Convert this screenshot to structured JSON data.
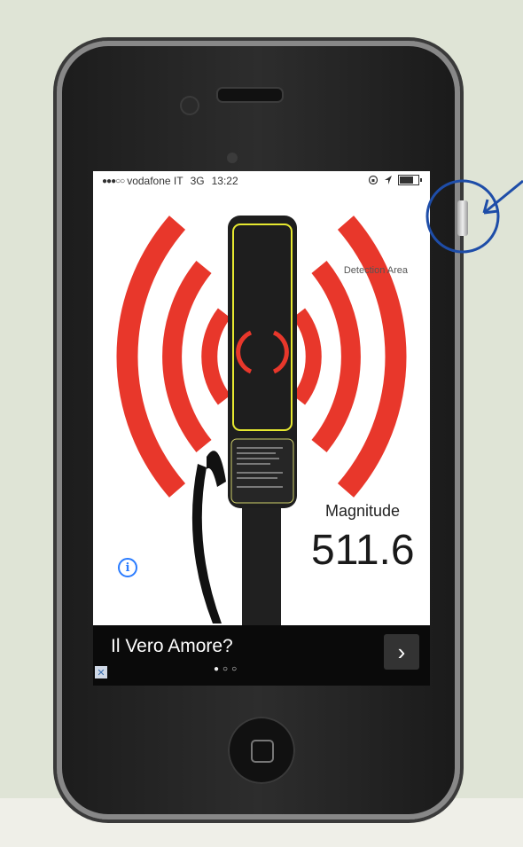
{
  "status_bar": {
    "signal": "●●●○○",
    "carrier": "vodafone IT",
    "network": "3G",
    "time": "13:22",
    "battery_level": 0.75
  },
  "detector": {
    "area_label": "Detection Area",
    "magnitude_label": "Magnitude",
    "magnitude_value": "511.6",
    "info_symbol": "i",
    "colors": {
      "waves": "#e8372b",
      "device": "#1e1e1e",
      "outline": "#e6e830"
    }
  },
  "ad_banner": {
    "title": "Il Vero Amore?",
    "pager": "●○○",
    "next_symbol": "›",
    "close_symbol": "✕"
  },
  "annotation": {
    "color": "#1e4da8",
    "icon": "arrow-circle-annotation"
  }
}
